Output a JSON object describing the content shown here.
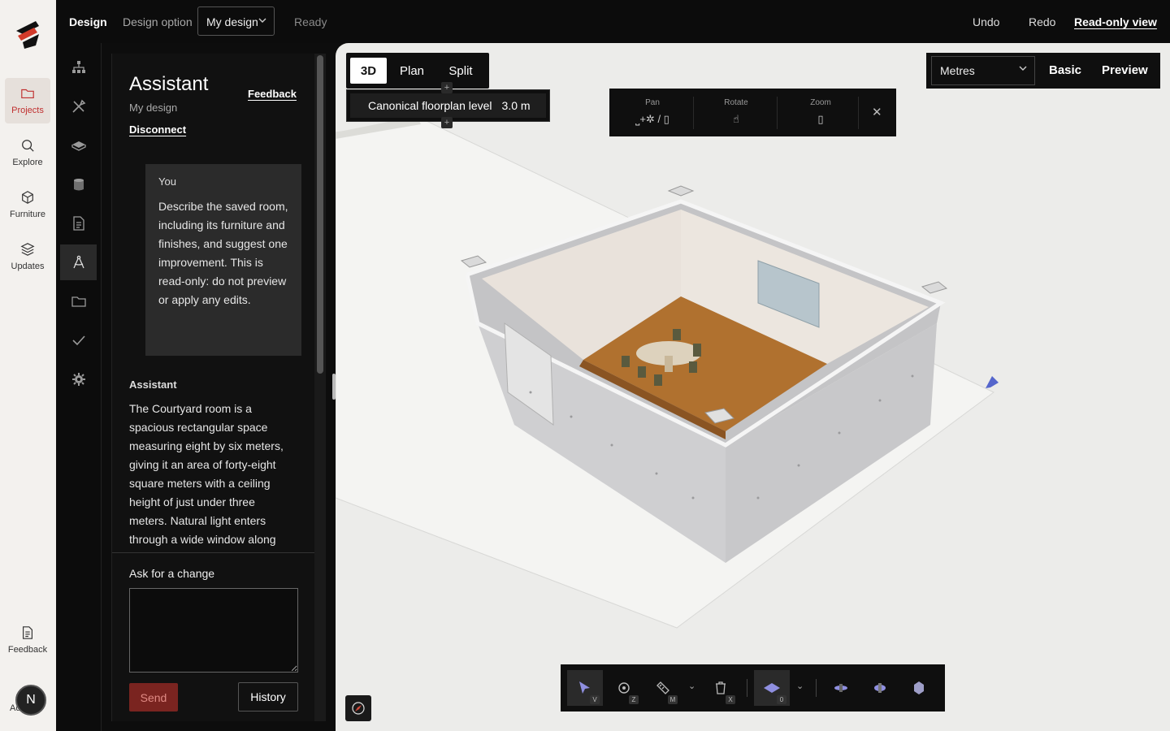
{
  "rail": {
    "items": [
      {
        "label": "Projects",
        "icon": "folder-icon"
      },
      {
        "label": "Explore",
        "icon": "search-icon"
      },
      {
        "label": "Furniture",
        "icon": "cube-icon"
      },
      {
        "label": "Updates",
        "icon": "layers-icon"
      },
      {
        "label": "Feedback",
        "icon": "document-icon"
      }
    ],
    "avatar_initial": "N",
    "avatar_caption": "Ac",
    "accent": "#c03030"
  },
  "topbar": {
    "design": "Design",
    "design_option": "Design option",
    "select_value": "My design",
    "status": "Ready",
    "undo": "Undo",
    "redo": "Redo",
    "readonly": "Read-only view"
  },
  "assistant": {
    "title": "Assistant",
    "subtitle": "My design",
    "feedback": "Feedback",
    "disconnect": "Disconnect",
    "user_label": "You",
    "user_message": "Describe the saved room, including its furniture and finishes, and suggest one improvement. This is read-only: do not preview or apply any edits.",
    "assistant_label": "Assistant",
    "assistant_message": "The Courtyard room is a spacious rectangular space measuring eight by six meters, giving it an area of forty-eight square meters with a ceiling height of just under three meters. Natural light enters through a wide window along",
    "ask_label": "Ask for a change",
    "ask_value": "",
    "send": "Send",
    "history": "History"
  },
  "viewport": {
    "tabs": [
      "3D",
      "Plan",
      "Split"
    ],
    "active_tab": "3D",
    "level_label": "Canonical floorplan level",
    "level_value": "3.0 m",
    "nav": {
      "pan": "Pan",
      "rotate": "Rotate",
      "zoom": "Zoom"
    },
    "units": "Metres",
    "basic": "Basic",
    "preview": "Preview",
    "tool_keys": {
      "select": "V",
      "orbit": "Z",
      "measure": "M",
      "delete": "X",
      "floor": "0"
    }
  }
}
